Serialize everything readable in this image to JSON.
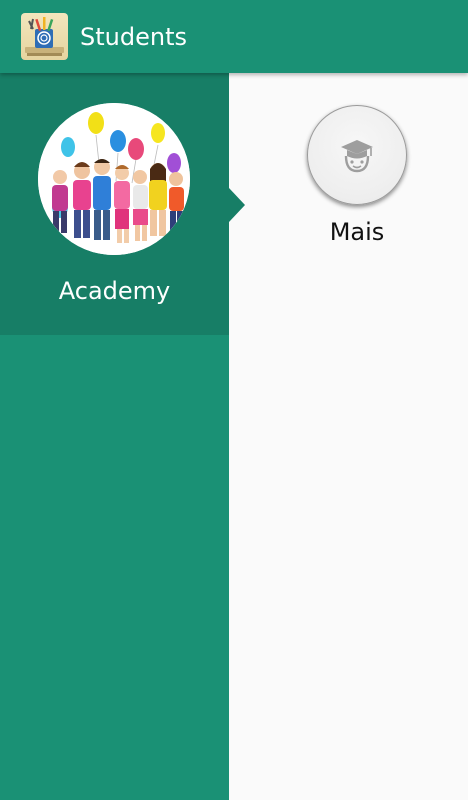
{
  "app_bar": {
    "title": "Students",
    "app_icon": "desk-supplies-icon",
    "color": "#1a9175"
  },
  "sidebar": {
    "background": "#1a9175",
    "selected_background": "#177e66",
    "items": [
      {
        "label": "Academy",
        "image": "children-with-balloons-photo",
        "selected": true
      }
    ]
  },
  "main": {
    "options": [
      {
        "label": "Mais",
        "icon": "graduate-student-icon"
      }
    ]
  }
}
